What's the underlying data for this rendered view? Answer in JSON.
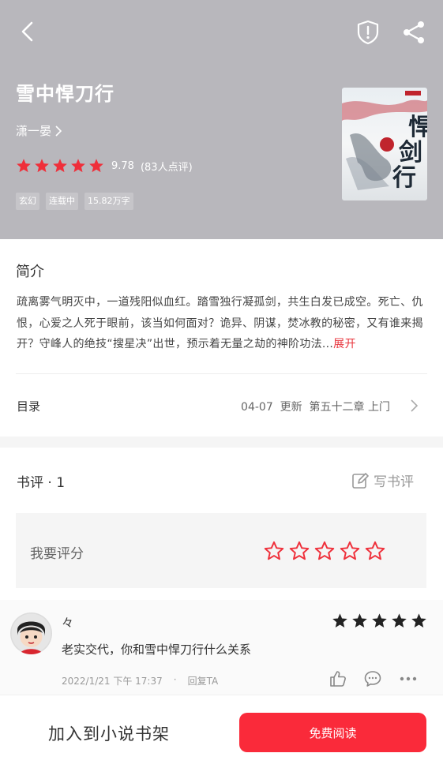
{
  "book": {
    "title": "雪中悍刀行",
    "author": "潇一晏",
    "score": "9.78",
    "rating_count": "(83人点评)",
    "rating_stars": 5,
    "tags": [
      "玄幻",
      "连载中",
      "15.82万字"
    ],
    "cover_text": "雪中悍剑行"
  },
  "intro": {
    "heading": "简介",
    "text": "疏离雾气明灭中，一道残阳似血红。踏雪独行凝孤剑，共生白发已成空。死亡、仇恨，心爱之人死于眼前，该当如何面对？诡异、阴谋，焚冰教的秘密，又有谁来揭开？守峰人的绝技“搜星决”出世，预示着无量之劫的神阶功法...",
    "expand_label": "展开"
  },
  "toc": {
    "label": "目录",
    "date": "04-07",
    "update_label": "更新",
    "latest_chapter": "第五十二章 上门"
  },
  "reviews": {
    "heading": "书评 · 1",
    "write_label": "写书评",
    "rate_prompt": "我要评分",
    "items": [
      {
        "user": "々",
        "stars": 5,
        "text": "老实交代，你和雪中悍刀行什么关系",
        "time": "2022/1/21 下午 17:37",
        "reply_label": "回复TA"
      }
    ]
  },
  "bottom": {
    "add_shelf_label": "加入到小说书架",
    "read_label": "免费阅读"
  },
  "colors": {
    "header_bg": "#b8b7bc",
    "accent_red": "#fa2a3a",
    "star_red": "#ef2f3a"
  },
  "icons": [
    "back-arrow-icon",
    "shield-icon",
    "share-icon",
    "chevron-right-icon",
    "edit-icon",
    "thumbs-up-icon",
    "comment-icon",
    "more-icon"
  ]
}
